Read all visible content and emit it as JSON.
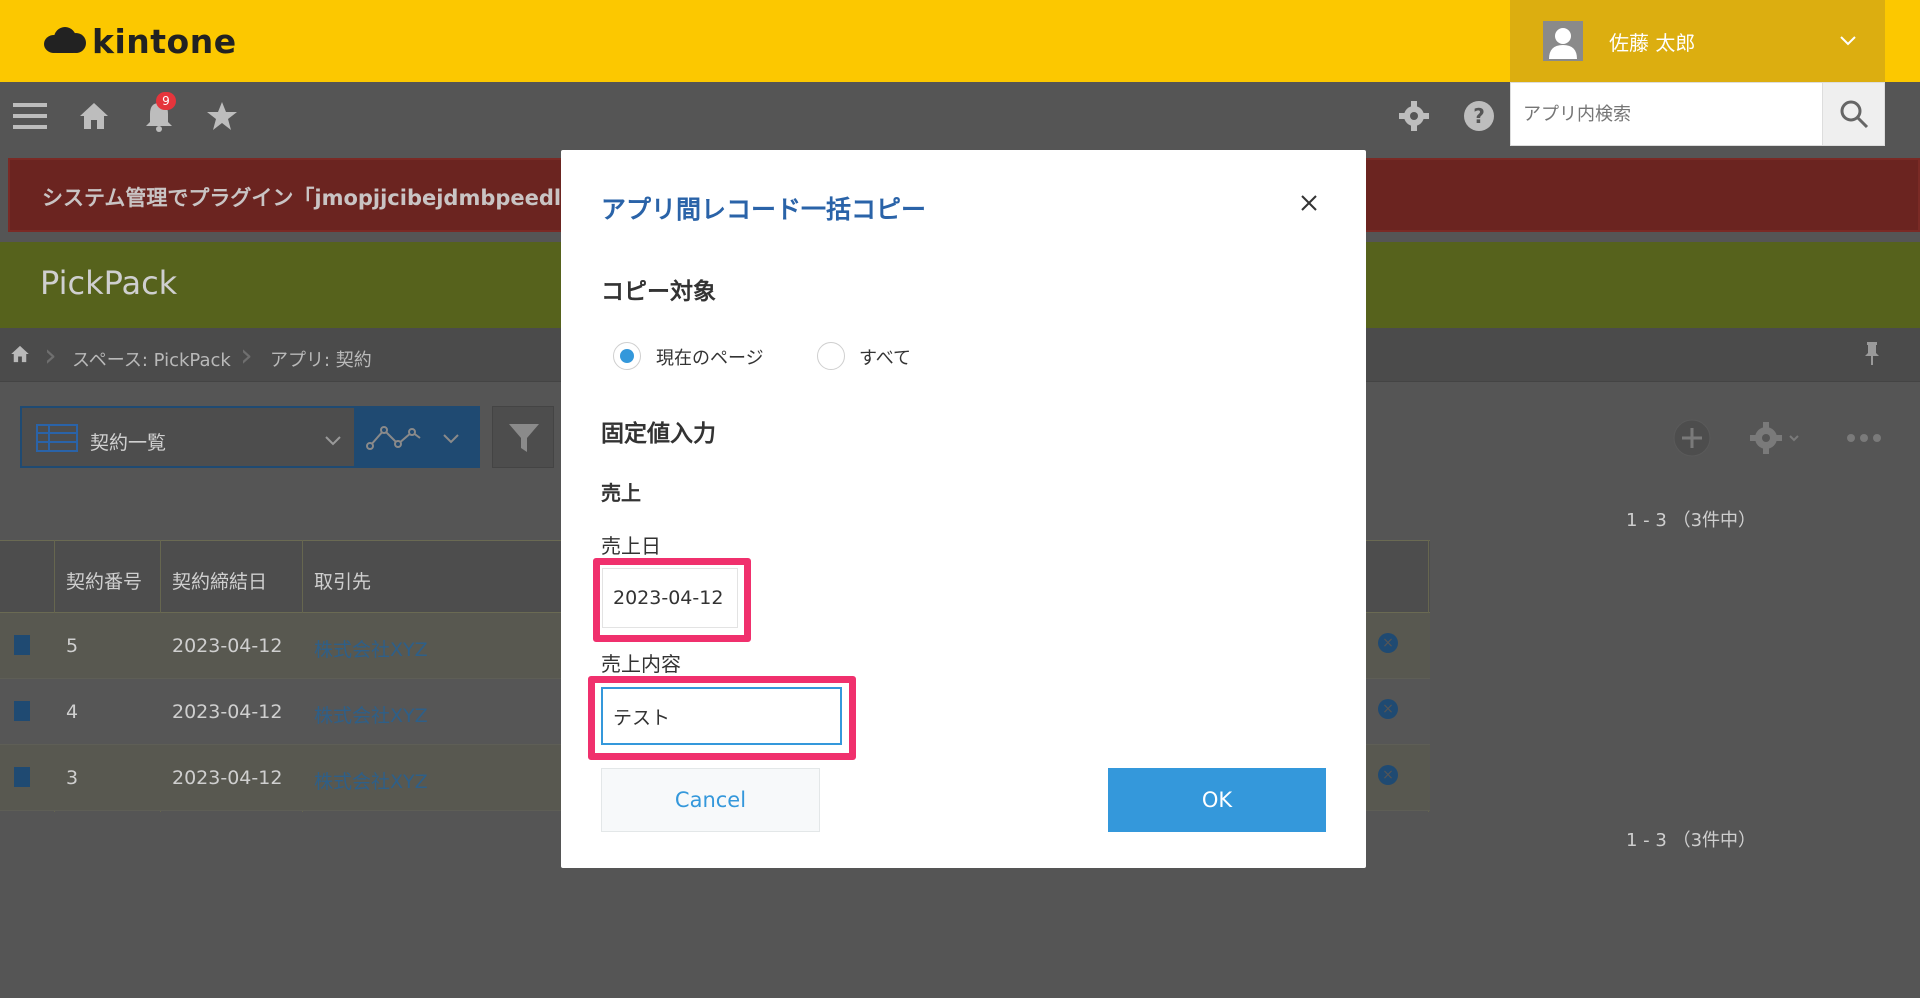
{
  "header": {
    "logo_text": "kintone",
    "user_name": "佐藤 太郎"
  },
  "nav": {
    "notification_count": "9",
    "search_placeholder": "アプリ内検索"
  },
  "banner": {
    "text": "システム管理でプラグイン「jmopjjcibejdmbpeedl"
  },
  "space": {
    "title": "PickPack"
  },
  "breadcrumb": {
    "space": "スペース: PickPack",
    "app": "アプリ: 契約"
  },
  "toolbar": {
    "view_name": "契約一覧",
    "count_top": "1 - 3 （3件中）",
    "count_bottom": "1 - 3 （3件中）"
  },
  "table": {
    "columns": [
      "契約番号",
      "契約締結日",
      "取引先"
    ],
    "rows": [
      {
        "no": "5",
        "date": "2023-04-12",
        "client": "株式会社XYZ"
      },
      {
        "no": "4",
        "date": "2023-04-12",
        "client": "株式会社XYZ"
      },
      {
        "no": "3",
        "date": "2023-04-12",
        "client": "株式会社XYZ"
      }
    ]
  },
  "modal": {
    "title": "アプリ間レコード一括コピー",
    "copy_target_title": "コピー対象",
    "radio_current": "現在のページ",
    "radio_all": "すべて",
    "selected": "現在のページ",
    "fixed_input_title": "固定値入力",
    "sales_title": "売上",
    "sales_date_label": "売上日",
    "sales_date_value": "2023-04-12",
    "sales_content_label": "売上内容",
    "sales_content_value": "テスト",
    "cancel_label": "Cancel",
    "ok_label": "OK"
  },
  "colors": {
    "header_yellow": "#fcc800",
    "accent_blue": "#3498db",
    "highlight_pink": "#f0306d",
    "title_blue": "#2a63a8"
  }
}
